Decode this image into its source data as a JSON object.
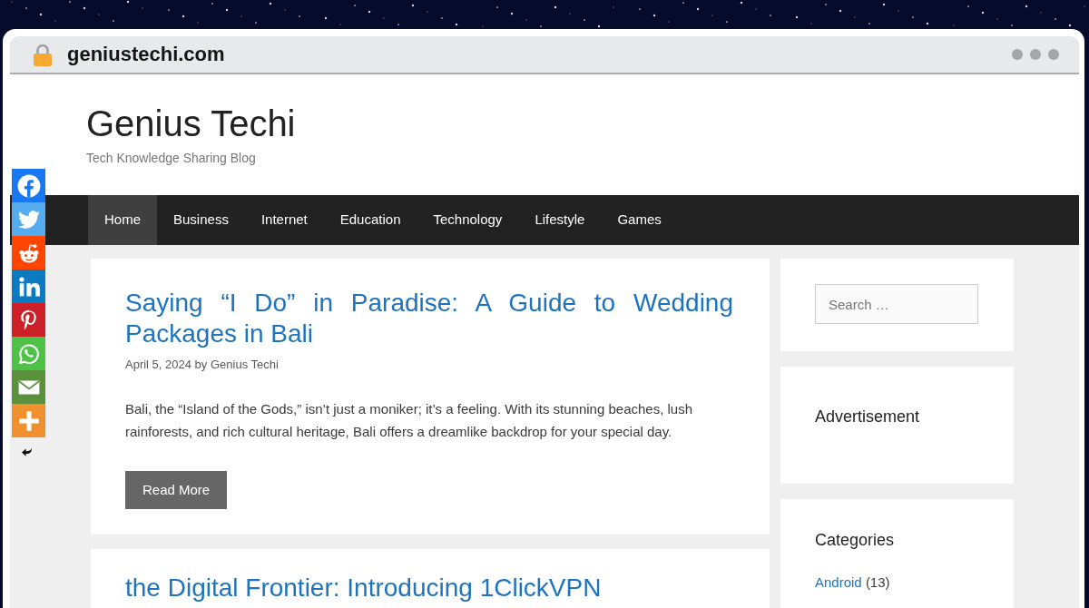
{
  "browser": {
    "url": "geniustechi.com"
  },
  "site": {
    "title": "Genius Techi",
    "tagline": "Tech Knowledge Sharing Blog"
  },
  "nav": [
    {
      "label": "Home",
      "selected": true
    },
    {
      "label": "Business",
      "selected": false
    },
    {
      "label": "Internet",
      "selected": false
    },
    {
      "label": "Education",
      "selected": false
    },
    {
      "label": "Technology",
      "selected": false
    },
    {
      "label": "Lifestyle",
      "selected": false
    },
    {
      "label": "Games",
      "selected": false
    }
  ],
  "share_bar": [
    {
      "kind": "facebook",
      "color": "#1877f2"
    },
    {
      "kind": "twitter",
      "color": "#55acee"
    },
    {
      "kind": "reddit",
      "color": "#ff4500"
    },
    {
      "kind": "linkedin",
      "color": "#0a7bc1"
    },
    {
      "kind": "pinterest",
      "color": "#cb2027"
    },
    {
      "kind": "whatsapp",
      "color": "#4dc247"
    },
    {
      "kind": "email",
      "color": "#5a8f3c"
    },
    {
      "kind": "more",
      "color": "#f0902f"
    }
  ],
  "posts": [
    {
      "title": "Saying “I Do” in Paradise: A Guide to Wedding Packages in Bali",
      "meta": "April 5, 2024 by Genius Techi",
      "excerpt": "Bali, the “Island of the Gods,” isn’t just a moniker; it’s a feeling. With its stunning beaches, lush rainforests, and rich cultural heritage, Bali offers a dreamlike backdrop for your special day.",
      "button": "Read More"
    },
    {
      "title": "the Digital Frontier: Introducing 1ClickVPN"
    }
  ],
  "sidebar": [
    {
      "kind": "search",
      "placeholder": "Search …"
    },
    {
      "kind": "ad",
      "title": "Advertisement"
    },
    {
      "kind": "categories",
      "title": "Categories",
      "items": [
        {
          "name": "Android",
          "count": "(13)"
        }
      ]
    }
  ]
}
